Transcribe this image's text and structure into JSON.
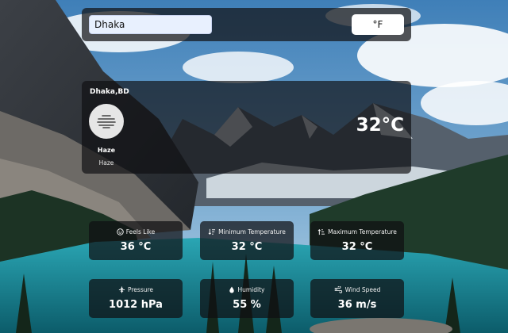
{
  "search": {
    "value": "Dhaka",
    "unit_button_label": "°F"
  },
  "current": {
    "location": "Dhaka,BD",
    "condition": "Haze",
    "description": "Haze",
    "temperature": "32°C",
    "icon": "haze-icon"
  },
  "details": [
    {
      "label": "Feels Like",
      "value": "36 °C",
      "icon": "smile-icon"
    },
    {
      "label": "Minimum Temperature",
      "value": "32 °C",
      "icon": "temp-down-icon"
    },
    {
      "label": "Maximum Temperature",
      "value": "32 °C",
      "icon": "temp-up-icon"
    },
    {
      "label": "Pressure",
      "value": "1012 hPa",
      "icon": "compress-icon"
    },
    {
      "label": "Humidity",
      "value": "55 %",
      "icon": "droplet-icon"
    },
    {
      "label": "Wind Speed",
      "value": "36 m/s",
      "icon": "wind-icon"
    }
  ],
  "colors": {
    "panel_bg": "#141416",
    "text": "#ffffff",
    "button_bg": "#ffffff",
    "input_bg": "#e8f0fe"
  }
}
